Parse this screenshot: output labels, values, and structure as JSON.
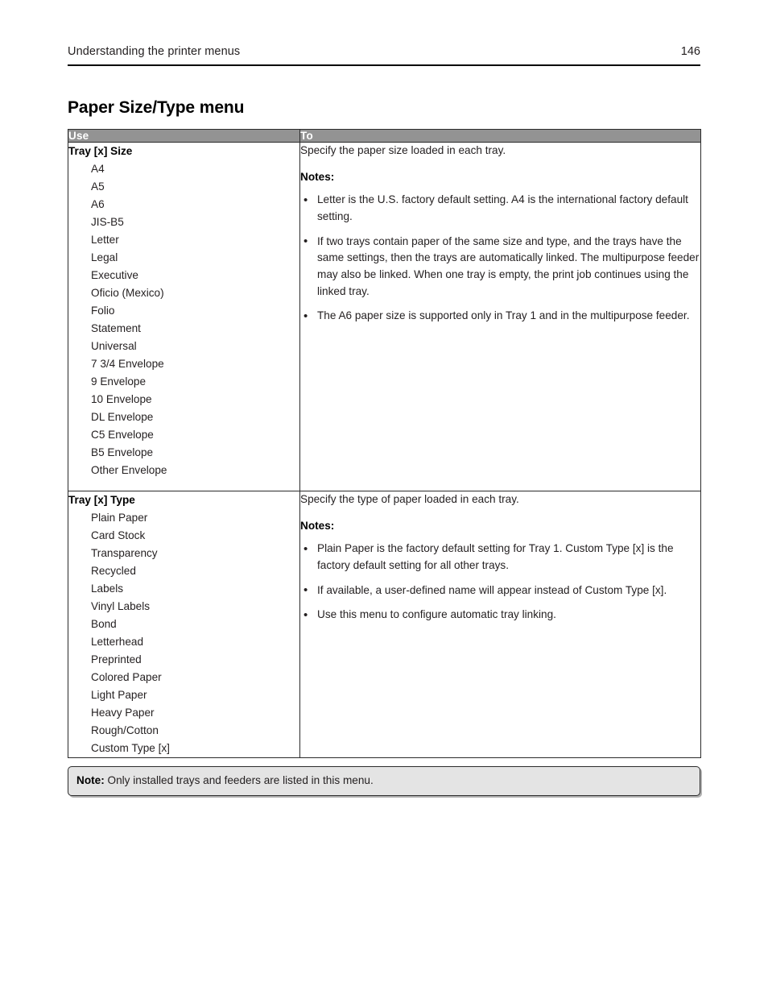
{
  "header": {
    "chapter_title": "Understanding the printer menus",
    "page_number": "146"
  },
  "section": {
    "title": "Paper Size/Type menu"
  },
  "table": {
    "columns": [
      "Use",
      "To"
    ],
    "rows": [
      {
        "use_heading": "Tray [x] Size",
        "use_options": [
          "A4",
          "A5",
          "A6",
          "JIS-B5",
          "Letter",
          "Legal",
          "Executive",
          "Oficio (Mexico)",
          "Folio",
          "Statement",
          "Universal",
          "7 3/4 Envelope",
          "9 Envelope",
          "10 Envelope",
          "DL Envelope",
          "C5 Envelope",
          "B5 Envelope",
          "Other Envelope"
        ],
        "to_lead": "Specify the paper size loaded in each tray.",
        "notes_label": "Notes:",
        "notes": [
          "Letter is the U.S. factory default setting. A4 is the international factory default setting.",
          "If two trays contain paper of the same size and type, and the trays have the same settings, then the trays are automatically linked. The multipurpose feeder may also be linked. When one tray is empty, the print job continues using the linked tray.",
          "The A6 paper size is supported only in Tray 1 and in the multipurpose feeder."
        ]
      },
      {
        "use_heading": "Tray [x] Type",
        "use_options": [
          "Plain Paper",
          "Card Stock",
          "Transparency",
          "Recycled",
          "Labels",
          "Vinyl Labels",
          "Bond",
          "Letterhead",
          "Preprinted",
          "Colored Paper",
          "Light Paper",
          "Heavy Paper",
          "Rough/Cotton",
          "Custom Type [x]"
        ],
        "to_lead": "Specify the type of paper loaded in each tray.",
        "notes_label": "Notes:",
        "notes": [
          "Plain Paper is the factory default setting for Tray 1. Custom Type [x] is the factory default setting for all other trays.",
          "If available, a user-defined name will appear instead of Custom Type [x].",
          "Use this menu to configure automatic tray linking."
        ]
      }
    ],
    "footer_note_label": "Note:",
    "footer_note_text": " Only installed trays and feeders are listed in this menu."
  },
  "colors": {
    "table_header_bg": "#939393",
    "table_header_text": "#ffffff",
    "footer_note_bg": "#e4e4e4",
    "border": "#2b2b2b",
    "text": "#231f20"
  },
  "bullet_glyph": "•"
}
